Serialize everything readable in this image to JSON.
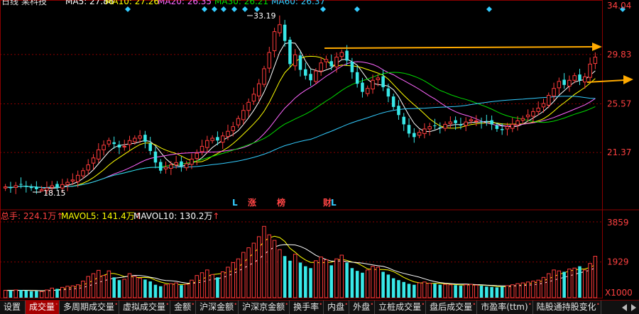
{
  "header": {
    "period_label": "日线",
    "stock_name": "某科技",
    "ma_items": [
      {
        "label": "MA5: 27.86",
        "color": "#ffffff"
      },
      {
        "label": "MA10: 27.26",
        "color": "#ffff00"
      },
      {
        "label": "MA20: 26.35",
        "color": "#ff66ff"
      },
      {
        "label": "MA30: 26.21",
        "color": "#00dd00"
      },
      {
        "label": "MA60: 26.37",
        "color": "#33ccff"
      }
    ]
  },
  "price_axis": {
    "labels": [
      "34.04",
      "29.83",
      "25.57",
      "21.37"
    ],
    "ymin": 17.4,
    "ymax": 34.04
  },
  "annotations": {
    "high_label": "33.19",
    "low_label": "18.15",
    "bottom_markers": [
      {
        "text": "L",
        "color": "#33ccff"
      },
      {
        "text": "涨",
        "color": "#ff4444"
      },
      {
        "text": "榜",
        "color": "#ff4444"
      },
      {
        "text": "财",
        "color": "#ff4444"
      },
      {
        "text": "L",
        "color": "#33ccff"
      }
    ]
  },
  "volume_header": {
    "total_label": "总手: 224.1万",
    "mavol5_label": "MAVOL5: 141.4万",
    "mavol10_label": "MAVOL10: 130.2万",
    "arrow": "↑"
  },
  "volume_axis": {
    "labels": [
      "3859",
      "1929"
    ],
    "unit": "X1000",
    "vmax": 4100
  },
  "tabs": [
    {
      "label": "设置",
      "active": false
    },
    {
      "label": "成交量",
      "active": true
    },
    {
      "label": "多周期成交量",
      "active": false
    },
    {
      "label": "虚拟成交量",
      "active": false
    },
    {
      "label": "金额",
      "active": false
    },
    {
      "label": "沪深金额",
      "active": false
    },
    {
      "label": "沪深京金额",
      "active": false
    },
    {
      "label": "换手率",
      "active": false
    },
    {
      "label": "内盘",
      "active": false
    },
    {
      "label": "外盘",
      "active": false
    },
    {
      "label": "立桩成交量",
      "active": false
    },
    {
      "label": "盘后成交量",
      "active": false
    },
    {
      "label": "市盈率(ttm)",
      "active": false
    },
    {
      "label": "陆股通持股变化",
      "active": false
    }
  ],
  "colors": {
    "up": "#ff3b3b",
    "down": "#38e8e8",
    "grid": "#8b0000",
    "axis_text": "#ff4040",
    "arrow": "#ffaa00"
  },
  "chart_data": {
    "type": "candlestick",
    "closes": [
      18.4,
      18.3,
      18.5,
      18.6,
      18.4,
      18.3,
      18.2,
      18.15,
      18.3,
      18.5,
      18.4,
      18.6,
      18.8,
      19.0,
      19.4,
      19.8,
      20.3,
      20.9,
      21.6,
      22.0,
      22.4,
      22.1,
      21.8,
      21.9,
      22.4,
      22.6,
      22.8,
      22.3,
      21.5,
      20.5,
      19.8,
      20.1,
      20.3,
      20.5,
      20.2,
      20.4,
      20.8,
      21.3,
      21.9,
      22.4,
      22.6,
      22.4,
      22.8,
      23.2,
      23.6,
      24.3,
      25.0,
      25.7,
      26.4,
      27.3,
      28.6,
      30.0,
      31.8,
      32.4,
      31.0,
      29.0,
      29.8,
      28.5,
      28.0,
      27.6,
      28.4,
      29.1,
      29.4,
      28.8,
      29.6,
      30.0,
      29.3,
      28.3,
      27.3,
      26.6,
      26.9,
      27.6,
      27.8,
      27.0,
      26.2,
      25.3,
      24.6,
      23.8,
      23.0,
      22.7,
      23.1,
      23.4,
      23.6,
      23.7,
      23.5,
      23.8,
      24.0,
      23.9,
      23.7,
      24.0,
      24.2,
      24.1,
      24.0,
      24.0,
      23.8,
      23.4,
      23.3,
      23.6,
      23.8,
      24.1,
      24.3,
      24.6,
      24.9,
      25.2,
      25.6,
      26.3,
      26.9,
      27.5,
      27.2,
      27.6,
      28.0,
      27.6,
      27.9,
      29.0,
      29.6
    ],
    "volumes": [
      400,
      380,
      420,
      410,
      390,
      350,
      360,
      330,
      420,
      520,
      480,
      560,
      620,
      640,
      700,
      900,
      1150,
      1300,
      1480,
      1200,
      1450,
      1100,
      950,
      1000,
      1300,
      1150,
      1050,
      980,
      880,
      700,
      620,
      700,
      760,
      800,
      680,
      720,
      950,
      1200,
      1350,
      1500,
      1250,
      1100,
      1400,
      1650,
      1900,
      2100,
      2450,
      2700,
      2950,
      3300,
      3859,
      3400,
      3100,
      2600,
      2250,
      2000,
      2350,
      1900,
      1700,
      1600,
      2000,
      2200,
      2050,
      1750,
      2100,
      2300,
      1900,
      1600,
      1450,
      1350,
      1500,
      1700,
      1650,
      1400,
      1250,
      1050,
      950,
      850,
      750,
      700,
      800,
      850,
      780,
      760,
      700,
      720,
      700,
      680,
      650,
      700,
      720,
      680,
      650,
      600,
      580,
      560,
      600,
      650,
      700,
      760,
      800,
      850,
      900,
      950,
      1100,
      1300,
      1500,
      1450,
      1400,
      1550,
      1600,
      1700,
      1500,
      1850,
      2241
    ]
  }
}
